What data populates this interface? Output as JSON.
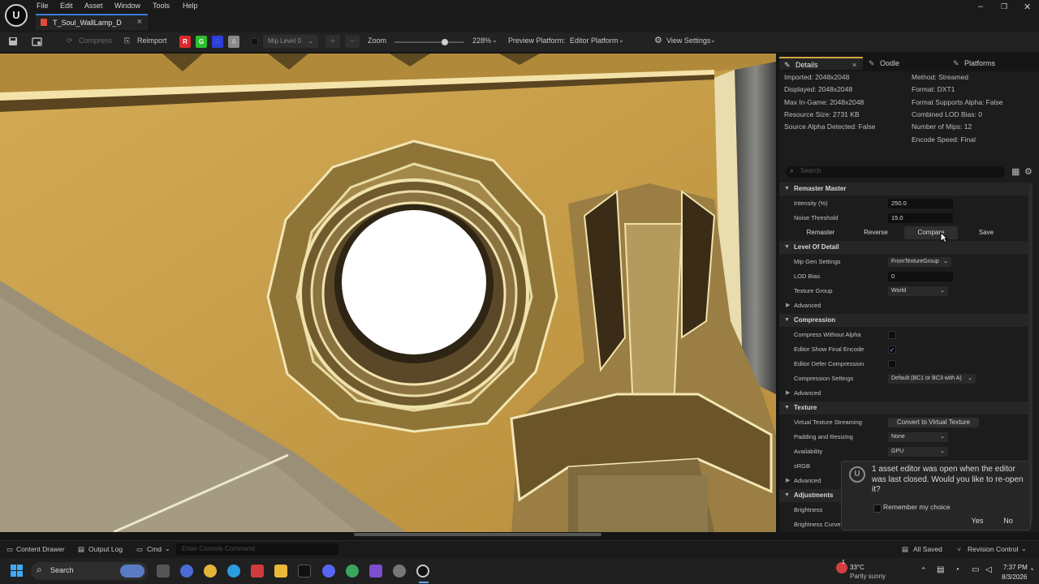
{
  "menu": [
    "File",
    "Edit",
    "Asset",
    "Window",
    "Tools",
    "Help"
  ],
  "document_tab": "T_Soul_WallLamp_D",
  "toolbar": {
    "compress": "Compress",
    "reimport": "Reimport",
    "channels": [
      "R",
      "G",
      "B",
      "A"
    ],
    "mip_level": "Mip Level 0",
    "zoom_label": "Zoom",
    "zoom_value": 0.72,
    "zoom_percent": "228%",
    "preview_platform_label": "Preview Platform:",
    "preview_platform_value": "Editor Platform",
    "view_settings": "View Settings"
  },
  "panel_tabs": [
    "Details",
    "Oodle",
    "Platforms"
  ],
  "texture_info_left": [
    "Imported: 2048x2048",
    "Displayed: 2048x2048",
    "Max In-Game: 2048x2048",
    "Resource Size: 2731 KB",
    "Source Alpha Detected: False"
  ],
  "texture_info_right": [
    "Method: Streamed",
    "Format: DXT1",
    "Format Supports Alpha: False",
    "Combined LOD Bias: 0",
    "Number of Mips: 12",
    "Encode Speed: Final"
  ],
  "search_placeholder": "Search",
  "remaster": {
    "title": "Remaster Master",
    "intensity_label": "Intensity (%)",
    "intensity_value": "250.0",
    "noise_label": "Noise Threshold",
    "noise_value": "15.0",
    "buttons": [
      "Remaster",
      "Reverse",
      "Compare",
      "Save"
    ]
  },
  "lod": {
    "title": "Level Of Detail",
    "mip_gen_label": "Mip Gen Settings",
    "mip_gen_value": "FromTextureGroup",
    "lod_bias_label": "LOD Bias",
    "lod_bias_value": "0",
    "texture_group_label": "Texture Group",
    "texture_group_value": "World",
    "advanced": "Advanced"
  },
  "compression": {
    "title": "Compression",
    "without_alpha_label": "Compress Without Alpha",
    "without_alpha_checked": false,
    "show_final_label": "Editor Show Final Encode",
    "show_final_checked": true,
    "defer_label": "Editor Defer Compression",
    "defer_checked": false,
    "settings_label": "Compression Settings",
    "settings_value": "Default (BC1 or BC3 with A)",
    "advanced": "Advanced"
  },
  "texture": {
    "title": "Texture",
    "vts_label": "Virtual Texture Streaming",
    "vts_button": "Convert to Virtual Texture",
    "padding_label": "Padding and Resizing",
    "padding_value": "None",
    "availability_label": "Availability",
    "availability_value": "GPU",
    "srgb_label": "sRGB",
    "advanced": "Advanced"
  },
  "adjustments": {
    "title": "Adjustments",
    "brightness_label": "Brightness",
    "brightness_curve_label": "Brightness Curve"
  },
  "notification": {
    "message": "1 asset editor was open when the editor was last closed. Would you like to re-open it?",
    "remember": "Remember my choice",
    "yes": "Yes",
    "no": "No"
  },
  "statusbar": {
    "content_drawer": "Content Drawer",
    "output_log": "Output Log",
    "cmd": "Cmd",
    "console_placeholder": "Enter Console Command",
    "all_saved": "All Saved",
    "revision_control": "Revision Control"
  },
  "taskbar": {
    "search": "Search",
    "weather_temp": "33°C",
    "weather_desc": "Partly sunny",
    "time": "7:37 PM",
    "date": "8/3/2026",
    "badge": "1"
  },
  "colors": {
    "accent": "#3a7bd5",
    "viewport_base": "#c5a04a",
    "red_channel": "#d92b2b",
    "green_channel": "#2bbf2b",
    "blue_channel": "#2b3fd9"
  }
}
